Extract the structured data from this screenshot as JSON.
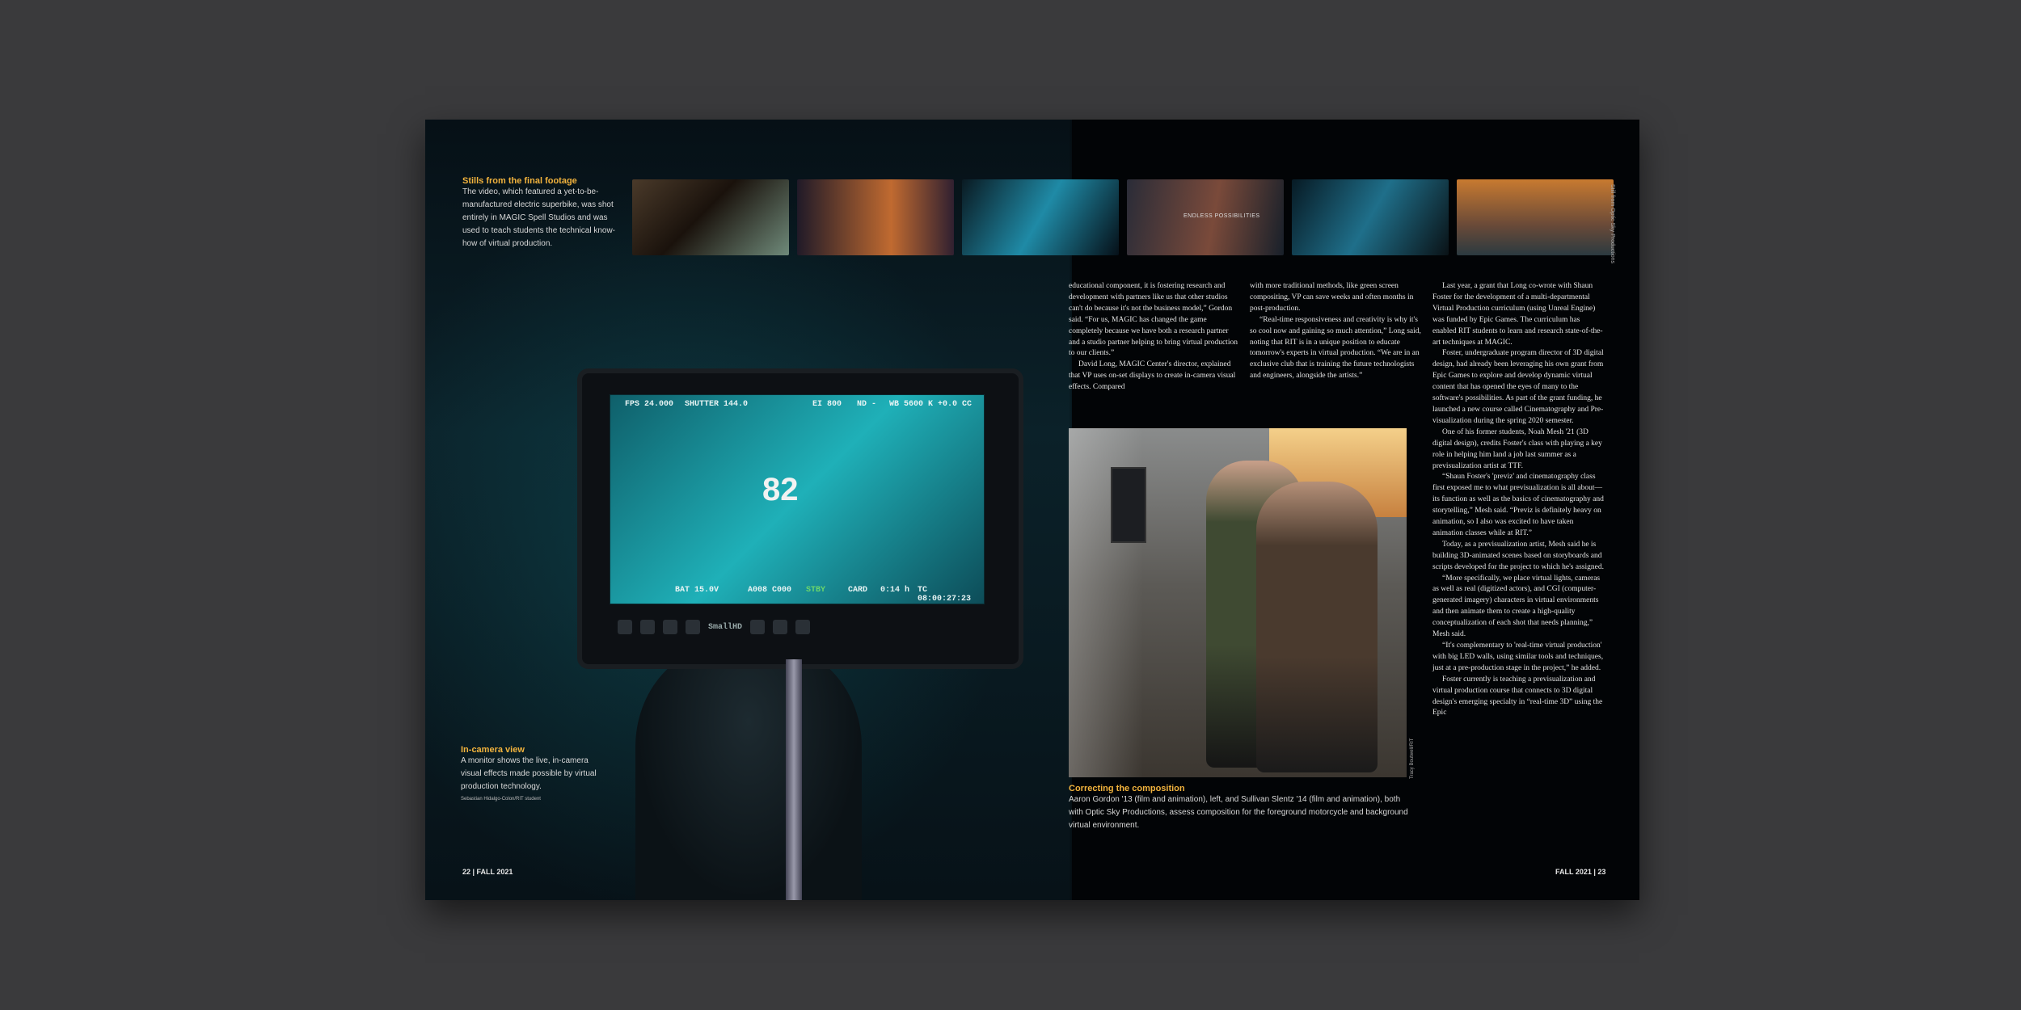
{
  "stills_caption": {
    "title": "Stills from the final footage",
    "body": "The video, which featured a yet-to-be-manufactured electric superbike, was shot entirely in MAGIC Spell Studios and was used to teach students the technical know-how of virtual production."
  },
  "stills": {
    "overlay_text": "ENDLESS POSSIBILITIES",
    "credit": "Still from Optic Sky Productions"
  },
  "monitor": {
    "osd_fps": "FPS 24.000",
    "osd_shutter": "SHUTTER 144.0",
    "osd_ei": "EI 800",
    "osd_nd": "ND -",
    "osd_wb": "WB 5600 K  +0.0 CC",
    "osd_bat": "BAT 15.0V",
    "osd_clip": "A008 C000",
    "osd_stby": "STBY",
    "osd_card": "CARD",
    "osd_remaining": "0:14 h",
    "osd_tc": "TC 08:00:27:23",
    "bike_number": "82",
    "brand": "SmallHD"
  },
  "camera_caption": {
    "title": "In-camera view",
    "body": "A monitor shows the live, in-camera visual effects made possible by virtual production technology.",
    "credit": "Sebastian Hidalgo-Colon/RIT student"
  },
  "article": {
    "col1": [
      "educational component, it is fostering research and development with partners like us that other studios can't do because it's not the business model,” Gordon said. “For us, MAGIC has changed the game completely because we have both a research partner and a studio partner helping to bring virtual production to our clients.”",
      "David Long, MAGIC Center's director, explained that VP uses on-set displays to create in-camera visual effects. Compared"
    ],
    "col2": [
      "with more traditional methods, like green screen compositing, VP can save weeks and often months in post-production.",
      "“Real-time responsiveness and creativity is why it's so cool now and gaining so much attention,” Long said, noting that RIT is in a unique position to educate tomorrow's experts in virtual production. “We are in an exclusive club that is training the future technologists and engineers, alongside the artists.”"
    ],
    "col3": [
      "Last year, a grant that Long co-wrote with Shaun Foster for the development of a multi-departmental Virtual Production curriculum (using Unreal Engine) was funded by Epic Games. The curriculum has enabled RIT students to learn and research state-of-the-art techniques at MAGIC.",
      "Foster, undergraduate program director of 3D digital design, had already been leveraging his own grant from Epic Games to explore and develop dynamic virtual content that has opened the eyes of many to the software's possibilities. As part of the grant funding, he launched a new course called Cinematography and Pre-visualization during the spring 2020 semester.",
      "One of his former students, Noah Mesh '21 (3D digital design), credits Foster's class with playing a key role in helping him land a job last summer as a previsualization artist at TTF.",
      "“Shaun Foster's 'previz' and cinematography class first exposed me to what previsualization is all about—its function as well as the basics of cinematography and storytelling,” Mesh said. “Previz is definitely heavy on animation, so I also was excited to have taken animation classes while at RIT.”",
      "Today, as a previsualization artist, Mesh said he is building 3D-animated scenes based on storyboards and scripts developed for the project to which he's assigned.",
      "“More specifically, we place virtual lights, cameras as well as real (digitized actors), and CGI (computer-generated imagery) characters in virtual environments and then animate them to create a high-quality conceptualization of each shot that needs planning,” Mesh said.",
      "“It's complementary to 'real-time virtual production' with big LED walls, using similar tools and techniques, just at a pre-production stage in the project,” he added.",
      "Foster currently is teaching a previsualization and virtual production course that connects to 3D digital design's emerging specialty in “real-time 3D” using the Epic"
    ]
  },
  "photo_caption": {
    "title": "Correcting the composition",
    "body": "Aaron Gordon '13 (film and animation), left, and Sullivan Slentz '14 (film and animation), both with Optic Sky Productions, assess composition for the foreground motorcycle and background virtual environment.",
    "credit": "Tracy Boutwell/RIT"
  },
  "folios": {
    "left": "22 | FALL 2021",
    "right": "FALL 2021 | 23"
  },
  "colors": {
    "background": "#3a3a3c",
    "page": "#05080c",
    "accent": "#f2b33d"
  }
}
